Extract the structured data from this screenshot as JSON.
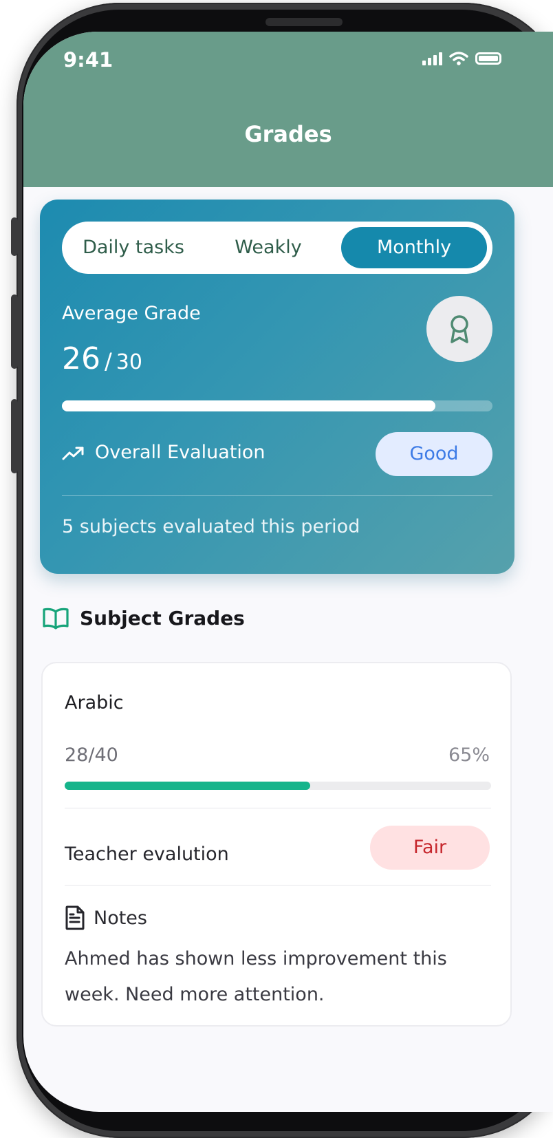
{
  "status_bar": {
    "time": "9:41"
  },
  "header": {
    "title": "Grades"
  },
  "summary": {
    "tabs": [
      {
        "label": "Daily tasks",
        "active": false
      },
      {
        "label": "Weakly",
        "active": false
      },
      {
        "label": "Monthly",
        "active": true
      }
    ],
    "average_label": "Average Grade",
    "average_score": "26",
    "average_max": "30",
    "average_fraction": 0.867,
    "evaluation_label": "Overall Evaluation",
    "evaluation_value": "Good",
    "subjects_count_text": "5 subjects evaluated this period"
  },
  "section": {
    "title": "Subject Grades"
  },
  "subject": {
    "name": "Arabic",
    "score": "28/40",
    "percent": "65%",
    "progress_fraction": 0.575,
    "teacher_label": "Teacher evalution",
    "teacher_value": "Fair",
    "notes_label": "Notes",
    "notes_text": "Ahmed has shown less improvement this week. Need more attention."
  },
  "colors": {
    "header": "#699c8a",
    "card_gradient_start": "#1d8bb0",
    "card_gradient_end": "#56a1ac",
    "active_tab": "#1589ac",
    "good_pill_bg": "#e3ecff",
    "good_pill_text": "#3d7be6",
    "fair_pill_bg": "#ffe1e2",
    "fair_pill_text": "#c6272d",
    "subject_progress": "#16b48b"
  },
  "icons": {
    "award": "award-icon",
    "trend": "trending-up-icon",
    "book": "book-open-icon",
    "notes": "file-text-icon"
  }
}
